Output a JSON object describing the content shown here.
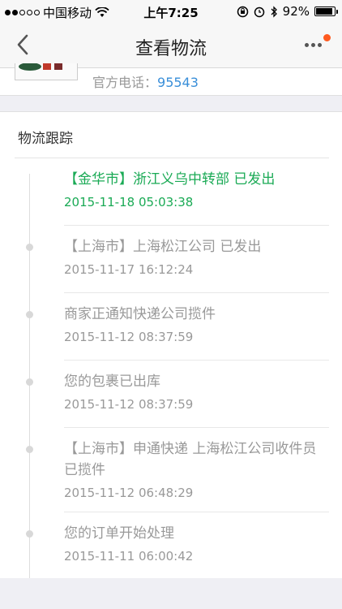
{
  "status_bar": {
    "carrier": "中国移动",
    "time": "上午7:25",
    "battery": "92%",
    "battery_level": 0.92
  },
  "nav": {
    "title": "查看物流",
    "back_icon": "chevron-left-icon",
    "more_icon": "more-dots-icon"
  },
  "shop": {
    "phone_label": "官方电话：",
    "phone_number": "95543"
  },
  "tracking": {
    "section_title": "物流跟踪",
    "events": [
      {
        "text": "【金华市】浙江义乌中转部 已发出",
        "time": "2015-11-18 05:03:38",
        "latest": true
      },
      {
        "text": "【上海市】上海松江公司 已发出",
        "time": "2015-11-17 16:12:24"
      },
      {
        "text": "商家正通知快递公司揽件",
        "time": "2015-11-12 08:37:59"
      },
      {
        "text": "您的包裹已出库",
        "time": "2015-11-12 08:37:59"
      },
      {
        "text": "【上海市】申通快递 上海松江公司收件员 已揽件",
        "time": "2015-11-12 06:48:29"
      },
      {
        "text": "您的订单开始处理",
        "time": "2015-11-11 06:00:42"
      }
    ]
  },
  "colors": {
    "latest": "#1aaa55",
    "link": "#3a8fd9",
    "badge": "#ff5a1f"
  }
}
